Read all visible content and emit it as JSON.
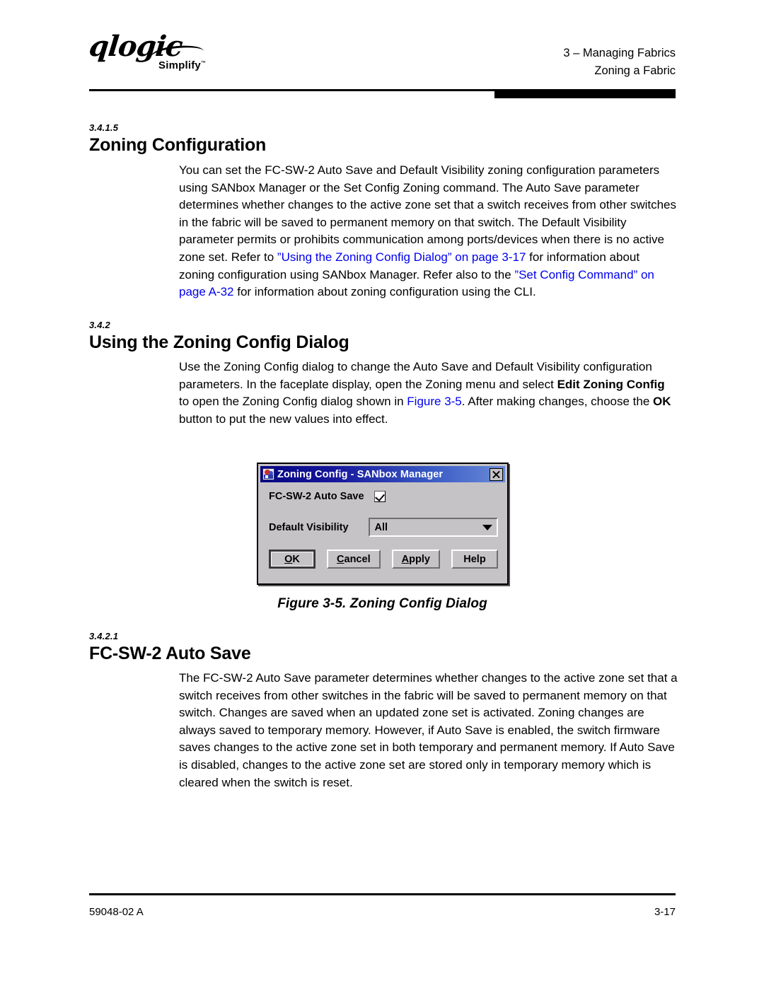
{
  "header": {
    "logo_text": "qlogic",
    "logo_tagline": "Simplify",
    "logo_tm": "™",
    "line1": "3 – Managing Fabrics",
    "line2": "Zoning a Fabric"
  },
  "sections": [
    {
      "number": "3.4.1.5",
      "title": "Zoning Configuration",
      "paragraph": {
        "part1": "You can set the FC-SW-2 Auto Save and Default Visibility zoning configuration parameters using SANbox Manager or the Set Config Zoning command. The Auto Save parameter determines whether changes to the active zone set that a switch receives from other switches in the fabric will be saved to permanent memory on that switch. The Default Visibility parameter permits or prohibits communication among ports/devices when there is no active zone set. Refer to ",
        "link1": "”Using the Zoning Config Dialog” on page 3-17",
        "part2": " for information about zoning configuration using SANbox Manager. Refer also to the ",
        "link2": "”Set Config Command” on page A-32",
        "part3": " for information about zoning configuration using the CLI."
      }
    },
    {
      "number": "3.4.2",
      "title": "Using the Zoning Config Dialog",
      "paragraph": {
        "part1": "Use the Zoning Config dialog to change the Auto Save and Default Visibility configuration parameters. In the faceplate display, open the Zoning menu and select ",
        "bold1": "Edit Zoning Config",
        "part2": " to open the Zoning Config dialog shown in ",
        "link1": "Figure 3-5",
        "part3": ". After making changes, choose the ",
        "bold2": "OK",
        "part4": " button to put the new values into effect."
      }
    },
    {
      "number": "3.4.2.1",
      "title": "FC-SW-2 Auto Save",
      "paragraph": {
        "part1": "The FC-SW-2 Auto Save parameter determines whether changes to the active zone set that a switch receives from other switches in the fabric will be saved to permanent memory on that switch. Changes are saved when an updated zone set is activated. Zoning changes are always saved to temporary memory. However, if Auto Save is enabled, the switch firmware saves changes to the active zone set in both temporary and permanent memory. If Auto Save is disabled, changes to the active zone set are stored only in temporary memory which is cleared when the switch is reset."
      }
    }
  ],
  "figure": {
    "caption": "Figure 3-5.  Zoning Config Dialog",
    "dialog": {
      "title": "Zoning Config - SANbox Manager",
      "icon_name": "sanbox-manager-app-icon",
      "close_label": "×",
      "auto_save_label": "FC-SW-2 Auto Save",
      "auto_save_checked": true,
      "visibility_label": "Default Visibility",
      "visibility_value": "All",
      "buttons": [
        {
          "label": "OK",
          "mnemonic": "O",
          "default": true
        },
        {
          "label": "Cancel",
          "mnemonic": "C",
          "default": false
        },
        {
          "label": "Apply",
          "mnemonic": "A",
          "default": false
        },
        {
          "label": "Help",
          "mnemonic": "",
          "default": false
        }
      ],
      "colors": {
        "titlebar_start": "#050583",
        "titlebar_end": "#6a8bd8",
        "face": "#c6c3c6"
      }
    }
  },
  "footer": {
    "doc_number": "59048-02 A",
    "page_number": "3-17"
  },
  "colors": {
    "link": "#0000ee",
    "text": "#000000"
  }
}
